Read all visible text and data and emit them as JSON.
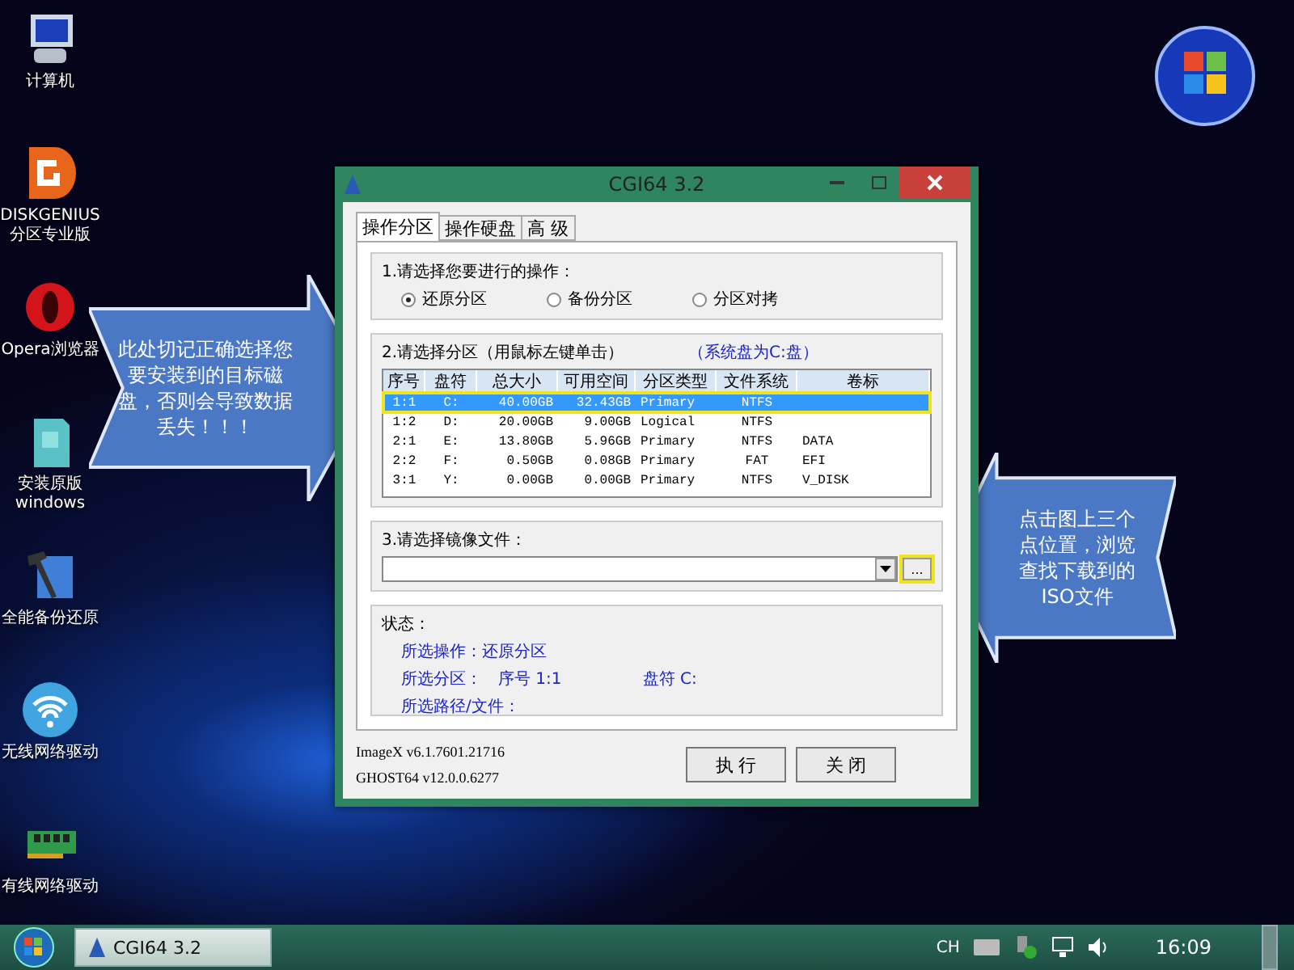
{
  "desktop_icons": [
    {
      "kind": "computer",
      "label": "计算机"
    },
    {
      "kind": "diskgenius",
      "label": "DISKGENIUS\n分区专业版"
    },
    {
      "kind": "opera",
      "label": "Opera浏览器"
    },
    {
      "kind": "installer",
      "label": "安装原版\nwindows"
    },
    {
      "kind": "backup",
      "label": "全能备份还原"
    },
    {
      "kind": "wifi",
      "label": "无线网络驱动"
    },
    {
      "kind": "nic",
      "label": "有线网络驱动"
    }
  ],
  "callouts": [
    {
      "kind": "right",
      "text": "此处切记正确选择您要安装到的目标磁盘，否则会导致数据丢失！！！"
    },
    {
      "kind": "left",
      "text": "点击图上三个点位置，浏览查找下载到的ISO文件"
    }
  ],
  "window": {
    "title": "CGI64  3.2",
    "tabs": [
      {
        "label": "操作分区",
        "selected": true
      },
      {
        "label": "操作硬盘",
        "selected": false
      },
      {
        "label": "高 级",
        "selected": false
      }
    ],
    "operation": {
      "label": "1.请选择您要进行的操作：",
      "options": [
        {
          "label": "还原分区",
          "selected": true
        },
        {
          "label": "备份分区",
          "selected": false
        },
        {
          "label": "分区对拷",
          "selected": false
        }
      ]
    },
    "partition": {
      "label": "2.请选择分区（用鼠标左键单击）",
      "note": "（系统盘为C:盘）",
      "columns": [
        "序号",
        "盘符",
        "总大小",
        "可用空间",
        "分区类型",
        "文件系统",
        "卷标"
      ],
      "rows": [
        {
          "selected": true,
          "cells": [
            "1:1",
            "C:",
            "40.00GB",
            "32.43GB",
            "Primary",
            "NTFS",
            ""
          ]
        },
        {
          "selected": false,
          "cells": [
            "1:2",
            "D:",
            "20.00GB",
            "9.00GB",
            "Logical",
            "NTFS",
            ""
          ]
        },
        {
          "selected": false,
          "cells": [
            "2:1",
            "E:",
            "13.80GB",
            "5.96GB",
            "Primary",
            "NTFS",
            "DATA"
          ]
        },
        {
          "selected": false,
          "cells": [
            "2:2",
            "F:",
            "0.50GB",
            "0.08GB",
            "Primary",
            "FAT",
            "EFI"
          ]
        },
        {
          "selected": false,
          "cells": [
            "3:1",
            "Y:",
            "0.00GB",
            "0.00GB",
            "Primary",
            "NTFS",
            "V_DISK"
          ]
        }
      ]
    },
    "image_file": {
      "label": "3.请选择镜像文件：",
      "browse": "...",
      "browse_highlighted": true
    },
    "status": {
      "title": "状态：",
      "lines": [
        [
          "所选操作：还原分区"
        ],
        [
          "所选分区：",
          "序号 1:1",
          "盘符 C:"
        ],
        [
          "所选路径/文件："
        ]
      ]
    },
    "versions": [
      "ImageX v6.1.7601.21716",
      "GHOST64 v12.0.0.6277"
    ],
    "buttons": [
      "执 行",
      "关 闭"
    ]
  },
  "taskbar": {
    "task": "CGI64  3.2",
    "language": "CH",
    "clock": "16:09"
  }
}
